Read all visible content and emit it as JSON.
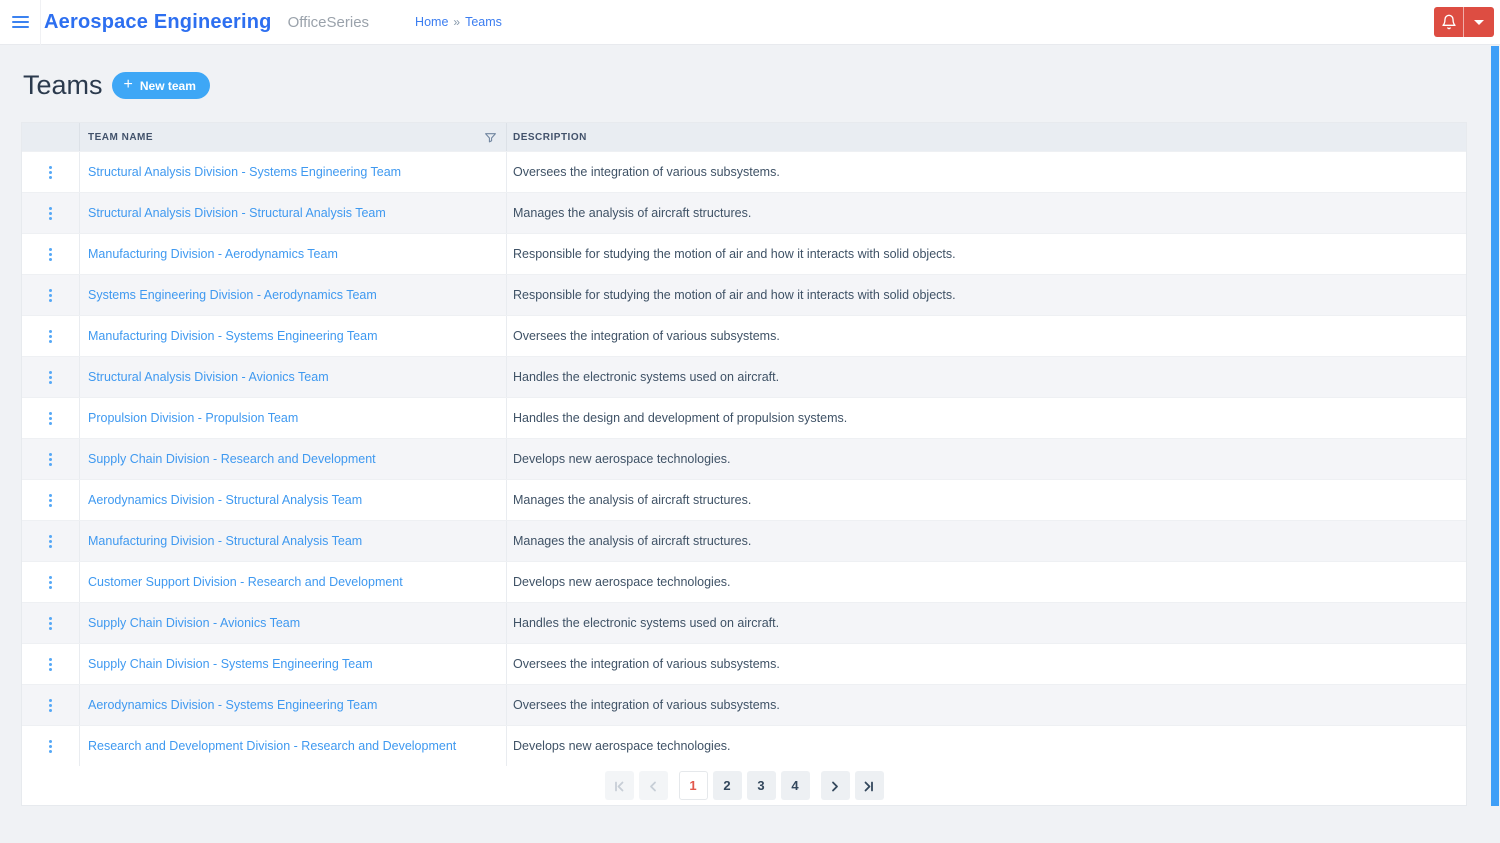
{
  "header": {
    "app_title": "Aerospace Engineering",
    "app_subtitle": "OfficeSeries",
    "breadcrumb": {
      "home": "Home",
      "separator": "»",
      "current": "Teams"
    },
    "icons": {
      "menu": "hamburger-icon",
      "notifications": "bell-icon",
      "account": "caret-down-icon"
    }
  },
  "page": {
    "title": "Teams",
    "new_team_button": {
      "icon": "+",
      "label": "New team"
    }
  },
  "table": {
    "columns": {
      "team_name": "TEAM NAME",
      "description": "DESCRIPTION"
    },
    "icons": {
      "filter": "filter-funnel-icon",
      "row_menu": "kebab-menu-icon"
    },
    "rows": [
      {
        "name": "Structural Analysis Division - Systems Engineering Team",
        "description": "Oversees the integration of various subsystems."
      },
      {
        "name": "Structural Analysis Division - Structural Analysis Team",
        "description": "Manages the analysis of aircraft structures."
      },
      {
        "name": "Manufacturing Division - Aerodynamics Team",
        "description": "Responsible for studying the motion of air and how it interacts with solid objects."
      },
      {
        "name": "Systems Engineering Division - Aerodynamics Team",
        "description": "Responsible for studying the motion of air and how it interacts with solid objects."
      },
      {
        "name": "Manufacturing Division - Systems Engineering Team",
        "description": "Oversees the integration of various subsystems."
      },
      {
        "name": "Structural Analysis Division - Avionics Team",
        "description": "Handles the electronic systems used on aircraft."
      },
      {
        "name": "Propulsion Division - Propulsion Team",
        "description": "Handles the design and development of propulsion systems."
      },
      {
        "name": "Supply Chain Division - Research and Development",
        "description": "Develops new aerospace technologies."
      },
      {
        "name": "Aerodynamics Division - Structural Analysis Team",
        "description": "Manages the analysis of aircraft structures."
      },
      {
        "name": "Manufacturing Division - Structural Analysis Team",
        "description": "Manages the analysis of aircraft structures."
      },
      {
        "name": "Customer Support Division - Research and Development",
        "description": "Develops new aerospace technologies."
      },
      {
        "name": "Supply Chain Division - Avionics Team",
        "description": "Handles the electronic systems used on aircraft."
      },
      {
        "name": "Supply Chain Division - Systems Engineering Team",
        "description": "Oversees the integration of various subsystems."
      },
      {
        "name": "Aerodynamics Division - Systems Engineering Team",
        "description": "Oversees the integration of various subsystems."
      },
      {
        "name": "Research and Development Division - Research and Development",
        "description": "Develops new aerospace technologies."
      }
    ]
  },
  "pagination": {
    "current_page": "1",
    "pages": [
      "1",
      "2",
      "3",
      "4"
    ],
    "icons": {
      "first": "first-page-icon",
      "previous": "chevron-left-icon",
      "next": "chevron-right-icon",
      "last": "last-page-icon"
    }
  },
  "colors": {
    "brand_blue": "#2d6ff0",
    "link_blue": "#3f99f0",
    "button_blue": "#3ea7f6",
    "alert_red": "#dd4d42",
    "active_page_text": "#e2574c",
    "table_header_bg": "#e9edf2",
    "row_alt_bg": "#f4f5f8",
    "scrollbar_blue": "#3f9ff7"
  }
}
